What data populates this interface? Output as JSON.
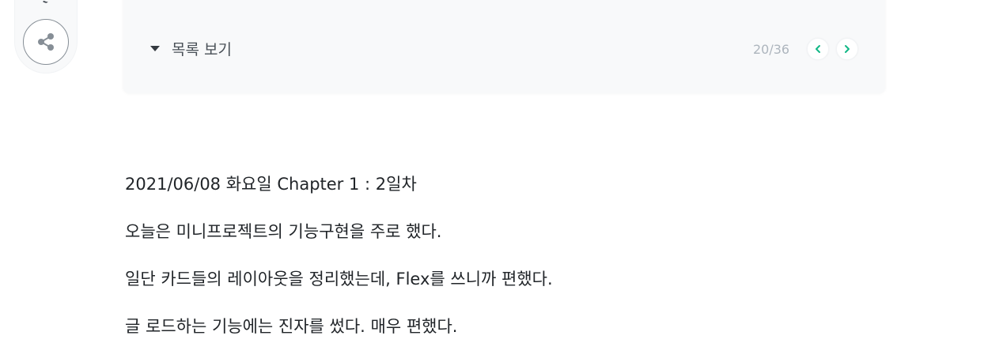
{
  "series": {
    "toggle_label": "목록 보기",
    "position": "20/36",
    "icons": {
      "toggle": "caret-down-icon",
      "prev": "chevron-left-icon",
      "next": "chevron-right-icon",
      "share": "share-icon"
    },
    "accent_color": "#12b886"
  },
  "post": {
    "paragraphs": [
      "2021/06/08 화요일 Chapter 1 : 2일차",
      "오늘은 미니프로젝트의 기능구현을 주로 했다.",
      "일단 카드들의 레이아웃을 정리했는데, Flex를 쓰니까 편했다.",
      "글 로드하는 기능에는 진자를 썼다. 매우 편했다."
    ]
  }
}
